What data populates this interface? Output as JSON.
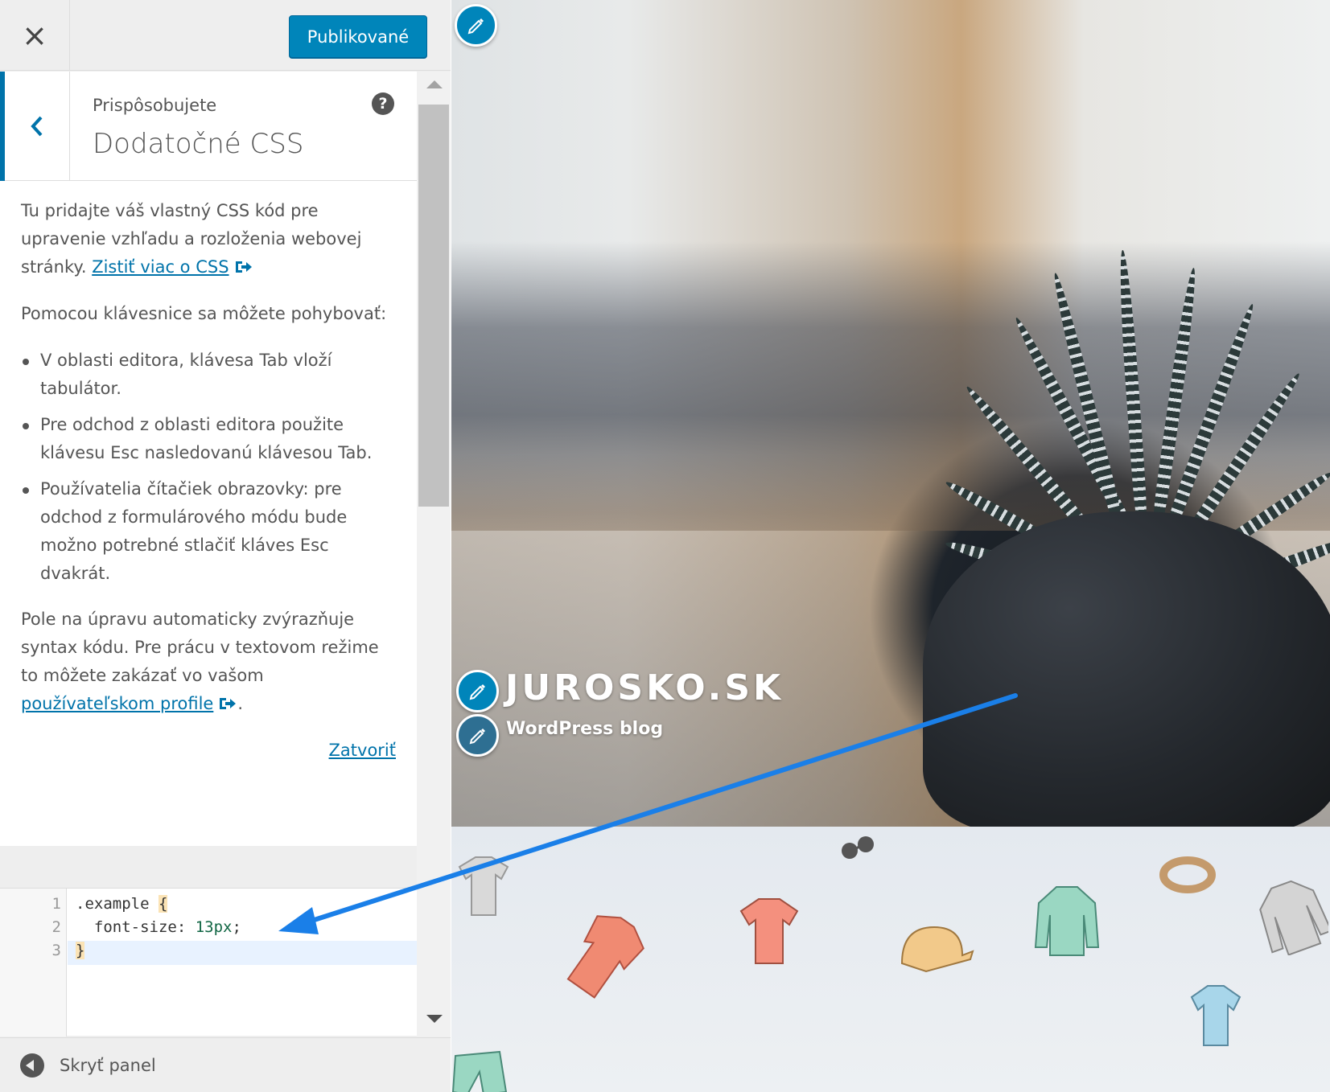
{
  "topbar": {
    "close_label": "×",
    "publish_label": "Publikované"
  },
  "section": {
    "customizing_label": "Prispôsobujete",
    "title": "Dodatočné CSS",
    "help_label": "?"
  },
  "description": {
    "intro_text": "Tu pridajte váš vlastný CSS kód pre upravenie vzhľadu a rozloženia webovej stránky. ",
    "intro_link": "Zistiť viac o CSS",
    "keyboard_heading": "Pomocou klávesnice sa môžete pohybovať:",
    "bullets": [
      "V oblasti editora, klávesa Tab vloží tabulátor.",
      "Pre odchod z oblasti editora použite klávesu Esc nasledovanú klávesou Tab.",
      "Používatelia čítačiek obrazovky: pre odchod z formulárového módu bude možno potrebné stlačiť kláves Esc dvakrát."
    ],
    "syntax_text": "Pole na úpravu automaticky zvýrazňuje syntax kódu. Pre prácu v textovom režime to môžete zakázať vo vašom ",
    "syntax_link": "používateľskom profile",
    "syntax_end": ".",
    "close_link": "Zatvoriť"
  },
  "editor": {
    "line_numbers": [
      "1",
      "2",
      "3"
    ],
    "line1_selector": ".example ",
    "line1_brace": "{",
    "line2_property": "  font-size: ",
    "line2_value": "13px",
    "line2_end": ";",
    "line3_brace": "}"
  },
  "collapse": {
    "label": "Skryť panel"
  },
  "preview": {
    "site_title": "JUROSKO.SK",
    "site_tagline": "WordPress blog"
  },
  "icons": {
    "close": "close-icon",
    "back": "chevron-left-icon",
    "help": "help-icon",
    "external": "external-link-icon",
    "pencil": "pencil-icon",
    "collapse": "arrow-left-circle-icon"
  },
  "colors": {
    "accent": "#0073aa",
    "publish": "#0085ba",
    "annotation_arrow": "#1a7fe8"
  }
}
